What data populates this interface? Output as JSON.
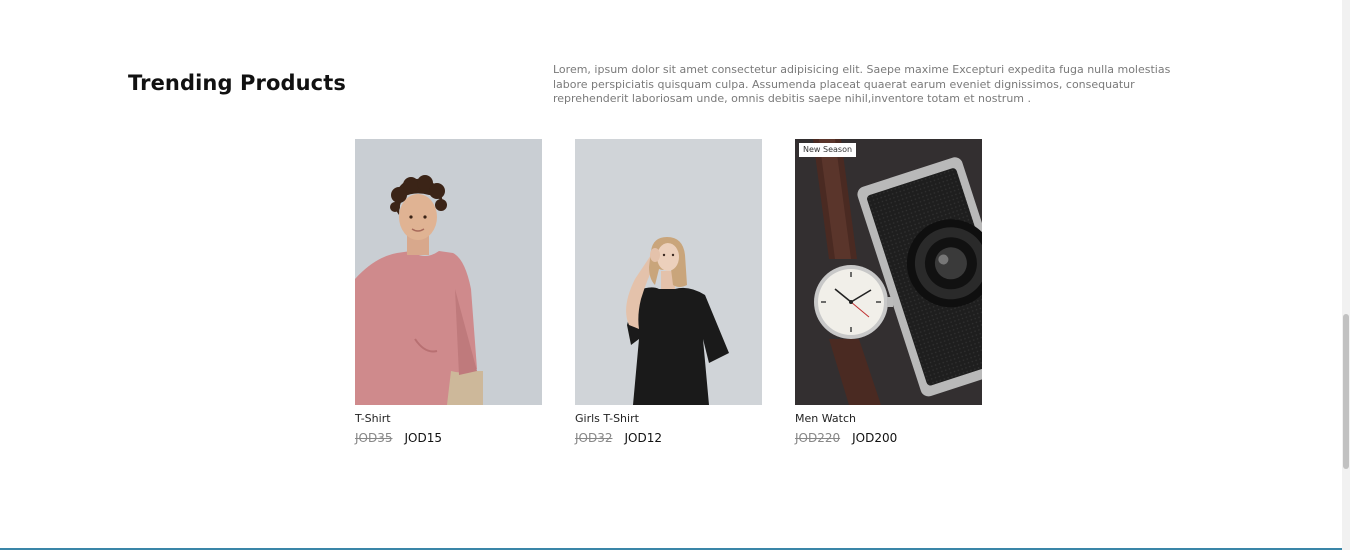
{
  "section": {
    "title": "Trending Products",
    "description": "Lorem, ipsum dolor sit amet consectetur adipisicing elit. Saepe maxime Excepturi expedita fuga nulla molestias labore perspiciatis quisquam culpa. Assumenda placeat quaerat earum eveniet dignissimos, consequatur reprehenderit laboriosam unde, omnis debitis saepe nihil,inventore totam et nostrum ."
  },
  "products": [
    {
      "name": "T-Shirt",
      "old_price": "JOD35",
      "price": "JOD15",
      "image": "man-pink-tshirt-photo"
    },
    {
      "name": "Girls T-Shirt",
      "old_price": "JOD32",
      "price": "JOD12",
      "image": "woman-black-tshirt-photo"
    },
    {
      "name": "Men Watch",
      "old_price": "JOD220",
      "price": "JOD200",
      "image": "watch-and-camera-photo",
      "badge": "New Season"
    }
  ],
  "colors": {
    "accent_border": "#3a86a8",
    "old_price": "#888888"
  }
}
